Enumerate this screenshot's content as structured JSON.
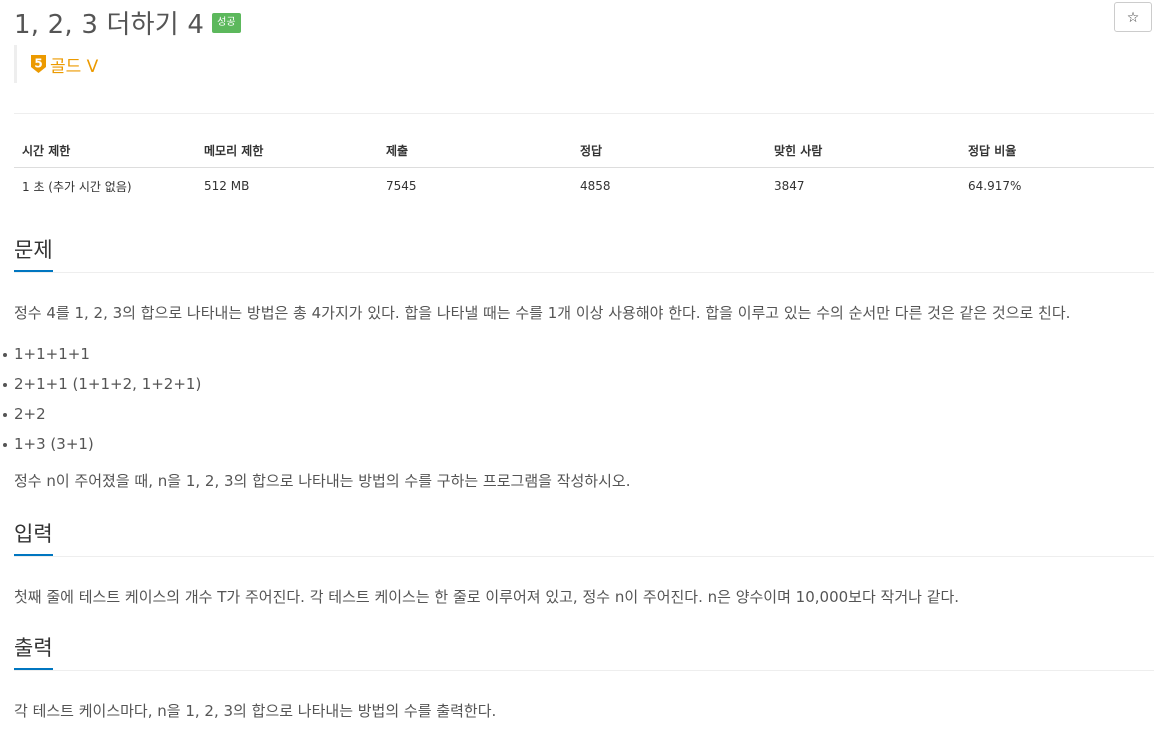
{
  "header": {
    "title": "1, 2, 3 더하기 4",
    "status_badge": "성공",
    "star_icon": "☆",
    "tier_number": "5",
    "tier_label": "골드 V"
  },
  "stats": {
    "headers": [
      "시간 제한",
      "메모리 제한",
      "제출",
      "정답",
      "맞힌 사람",
      "정답 비율"
    ],
    "values": [
      "1 초 (추가 시간 없음)",
      "512 MB",
      "7545",
      "4858",
      "3847",
      "64.917%"
    ]
  },
  "problem": {
    "title": "문제",
    "intro": "정수 4를 1, 2, 3의 합으로 나타내는 방법은 총 4가지가 있다. 합을 나타낼 때는 수를 1개 이상 사용해야 한다. 합을 이루고 있는 수의 순서만 다른 것은 같은 것으로 친다.",
    "examples": [
      "1+1+1+1",
      "2+1+1 (1+1+2, 1+2+1)",
      "2+2",
      "1+3 (3+1)"
    ],
    "question": "정수 n이 주어졌을 때, n을 1, 2, 3의 합으로 나타내는 방법의 수를 구하는 프로그램을 작성하시오."
  },
  "input": {
    "title": "입력",
    "text": "첫째 줄에 테스트 케이스의 개수 T가 주어진다. 각 테스트 케이스는 한 줄로 이루어져 있고, 정수 n이 주어진다. n은 양수이며 10,000보다 작거나 같다."
  },
  "output": {
    "title": "출력",
    "text": "각 테스트 케이스마다, n을 1, 2, 3의 합으로 나타내는 방법의 수를 출력한다."
  },
  "colors": {
    "accent": "#0076c0",
    "success": "#5cb85c",
    "gold": "#ec9a00"
  }
}
